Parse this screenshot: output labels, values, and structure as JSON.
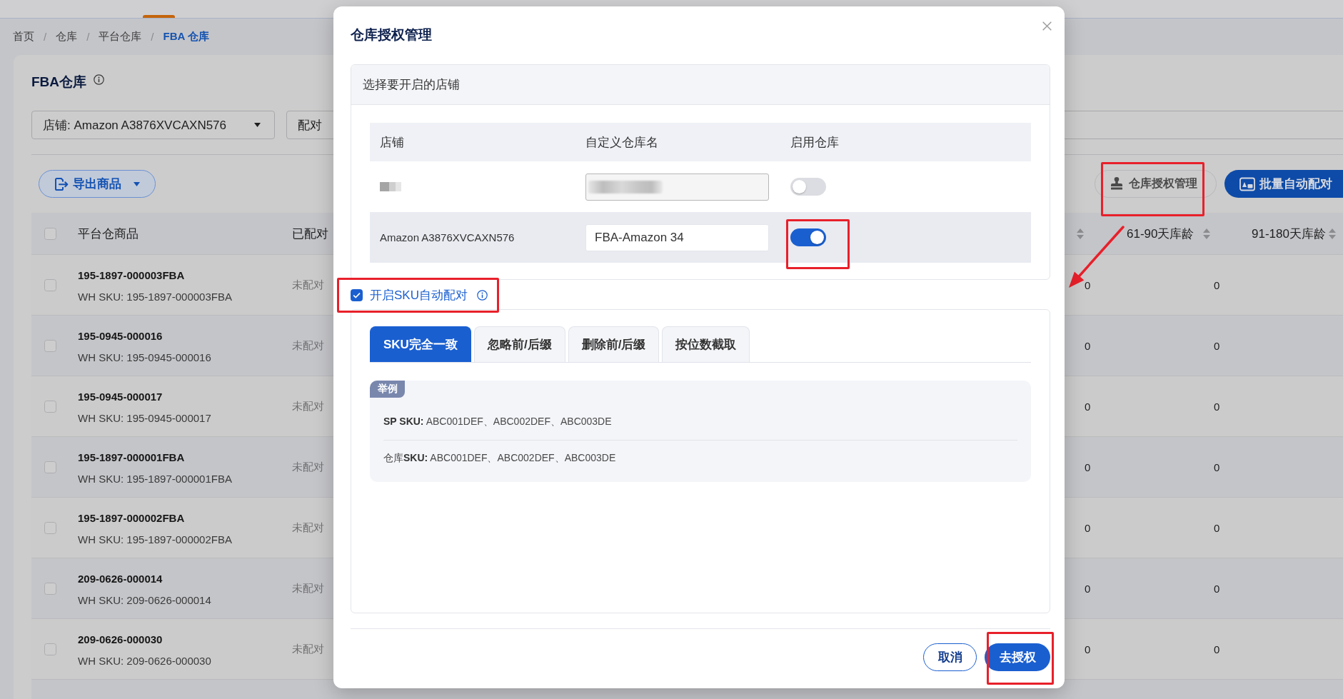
{
  "breadcrumb": [
    {
      "label": "首页",
      "separator": "/",
      "current": false
    },
    {
      "label": "仓库",
      "separator": "/",
      "current": false
    },
    {
      "label": "平台仓库",
      "separator": "/",
      "current": false
    },
    {
      "label": "FBA 仓库",
      "current": true
    }
  ],
  "page": {
    "title": "FBA仓库",
    "filters": [
      {
        "kind": "select",
        "label": "店铺: Amazon A3876XVCAXN576",
        "dropdown": true
      },
      {
        "kind": "select",
        "label": "配对"
      },
      {
        "kind": "input"
      }
    ],
    "toolbar": {
      "left": [
        {
          "kind": "outline",
          "label": "导出商品",
          "dropdown": true,
          "highlighted": false
        }
      ],
      "right": [
        {
          "kind": "ghost",
          "label": "仓库授权管理",
          "highlighted": true,
          "arrow": true
        },
        {
          "kind": "primary",
          "label": "批量自动配对",
          "highlighted": false
        }
      ]
    }
  },
  "table": {
    "select_all": {
      "checked": false
    },
    "columns": [
      {
        "label": "平台仓商品"
      },
      {
        "label": "已配对"
      },
      {
        "sortable": true
      },
      {
        "label": "61-90天库龄",
        "sortable": true
      },
      {
        "label": "91-180天库龄",
        "sortable": true
      }
    ],
    "rows": [
      {
        "checked": false,
        "name": "195-1897-000003FBA",
        "wh_sku": "WH SKU: 195-1897-000003FBA",
        "status": "未配对",
        "values": [
          "0",
          "0"
        ]
      },
      {
        "checked": false,
        "name": "195-0945-000016",
        "wh_sku": "WH SKU: 195-0945-000016",
        "status": "未配对",
        "values": [
          "0",
          "0"
        ]
      },
      {
        "checked": false,
        "name": "195-0945-000017",
        "wh_sku": "WH SKU: 195-0945-000017",
        "status": "未配对",
        "values": [
          "0",
          "0"
        ]
      },
      {
        "checked": false,
        "name": "195-1897-000001FBA",
        "wh_sku": "WH SKU: 195-1897-000001FBA",
        "status": "未配对",
        "values": [
          "0",
          "0"
        ]
      },
      {
        "checked": false,
        "name": "195-1897-000002FBA",
        "wh_sku": "WH SKU: 195-1897-000002FBA",
        "status": "未配对",
        "values": [
          "0",
          "0"
        ]
      },
      {
        "checked": false,
        "name": "209-0626-000014",
        "wh_sku": "WH SKU: 209-0626-000014",
        "status": "未配对",
        "values": [
          "0",
          "0"
        ]
      },
      {
        "checked": false,
        "name": "209-0626-000030",
        "wh_sku": "WH SKU: 209-0626-000030",
        "status": "未配对",
        "values": [
          "0",
          "0"
        ]
      }
    ]
  },
  "dialog": {
    "title": "仓库授权管理",
    "store_section": {
      "heading": "选择要开启的店铺",
      "columns": [
        "店铺",
        "自定义仓库名",
        "启用仓库"
      ],
      "rows": [
        {
          "redacted": true,
          "field_disabled": true,
          "enabled": false,
          "hovered": false,
          "highlighted": false
        },
        {
          "redacted": false,
          "store": "Amazon A3876XVCAXN576",
          "warehouse_name": "FBA-Amazon 34",
          "field_disabled": false,
          "enabled": true,
          "hovered": true,
          "highlighted": true
        }
      ]
    },
    "auto_match": {
      "label": "开启SKU自动配对",
      "checked": true,
      "highlighted": true
    },
    "match_tabs": [
      {
        "label": "SKU完全一致",
        "selected": true
      },
      {
        "label": "忽略前/后缀",
        "selected": false
      },
      {
        "label": "删除前/后缀",
        "selected": false
      },
      {
        "label": "按位数截取",
        "selected": false
      }
    ],
    "example": {
      "badge": "举例",
      "lines": [
        "**SP SKU:** ABC001DEF、ABC002DEF、ABC003DE",
        "仓库**SKU:** ABC001DEF、ABC002DEF、ABC003DE"
      ]
    },
    "buttons": [
      {
        "kind": "secondary",
        "label": "取消",
        "highlighted": false
      },
      {
        "kind": "primary",
        "label": "去授权",
        "highlighted": true
      }
    ]
  }
}
